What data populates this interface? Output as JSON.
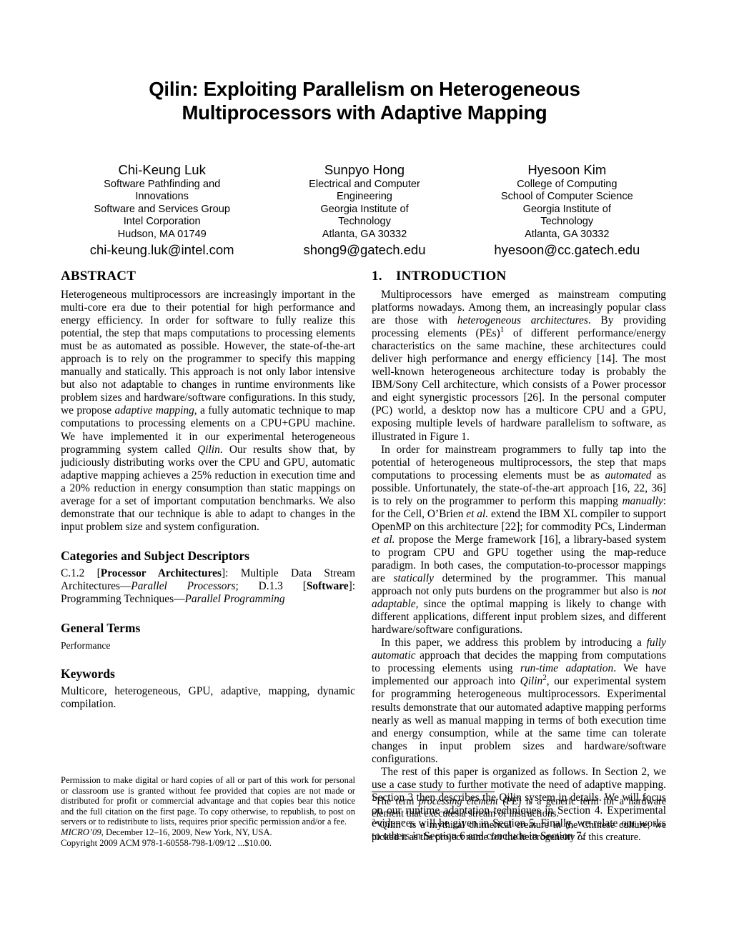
{
  "paper": {
    "title_line1": "Qilin: Exploiting Parallelism on Heterogeneous",
    "title_line2": "Multiprocessors with Adaptive Mapping"
  },
  "authors": [
    {
      "name": "Chi-Keung Luk",
      "affiliation_lines": [
        "Software Pathfinding and",
        "Innovations",
        "Software and Services Group",
        "Intel Corporation",
        "Hudson, MA 01749"
      ],
      "email": "chi-keung.luk@intel.com"
    },
    {
      "name": "Sunpyo Hong",
      "affiliation_lines": [
        "Electrical and Computer",
        "Engineering",
        "Georgia Institute of",
        "Technology",
        "Atlanta, GA 30332"
      ],
      "email": "shong9@gatech.edu"
    },
    {
      "name": "Hyesoon Kim",
      "affiliation_lines": [
        "College of Computing",
        "School of Computer Science",
        "Georgia Institute of",
        "Technology",
        "Atlanta, GA 30332"
      ],
      "email": "hyesoon@cc.gatech.edu"
    }
  ],
  "left_column": {
    "abstract_heading": "ABSTRACT",
    "abstract_text_p1": "Heterogeneous multiprocessors are increasingly important in the multi-core era due to their potential for high performance and energy efficiency. In order for software to fully realize this potential, the step that maps computations to processing elements must be as automated as possible. However, the state-of-the-art approach is to rely on the programmer to specify this mapping manually and statically. This approach is not only labor intensive but also not adaptable to changes in runtime environments like problem sizes and hardware/software configurations. In this study, we propose ",
    "abstract_italic_1": "adaptive mapping",
    "abstract_text_p2": ", a fully automatic technique to map computations to processing elements on a CPU+GPU machine. We have implemented it in our experimental heterogeneous programming system called ",
    "abstract_italic_2": "Qilin",
    "abstract_text_p3": ". Our results show that, by judiciously distributing works over the CPU and GPU, automatic adaptive mapping achieves a 25% reduction in execution time and a 20% reduction in energy consumption than static mappings on average for a set of important computation benchmarks. We also demonstrate that our technique is able to adapt to changes in the input problem size and system configuration.",
    "categories_heading": "Categories and Subject Descriptors",
    "categories_a": "C.1.2 [",
    "categories_b": "Processor Architectures",
    "categories_c": "]: Multiple Data Stream Architectures—",
    "categories_d": "Parallel Processors",
    "categories_e": "; D.1.3 [",
    "categories_f": "Software",
    "categories_g": "]: Programming Techniques—",
    "categories_h": "Parallel Programming",
    "general_terms_heading": "General Terms",
    "general_terms_text": "Performance",
    "keywords_heading": "Keywords",
    "keywords_text": "Multicore, heterogeneous, GPU, adaptive, mapping, dynamic compilation."
  },
  "right_column": {
    "intro_number": "1.",
    "intro_heading": "INTRODUCTION",
    "intro_p1_a": "Multiprocessors have emerged as mainstream computing platforms nowadays. Among them, an increasingly popular class are those with ",
    "intro_p1_it1": "heterogeneous architectures",
    "intro_p1_b": ". By providing processing elements (PEs)",
    "intro_p1_sup1": "1",
    "intro_p1_c": " of different performance/energy characteristics on the same machine, these architectures could deliver high performance and energy efficiency [14]. The most well-known heterogeneous architecture today is probably the IBM/Sony Cell architecture, which consists of a Power processor and eight synergistic processors [26]. In the personal computer (PC) world, a desktop now has a multicore CPU and a GPU, exposing multiple levels of hardware parallelism to software, as illustrated in Figure 1.",
    "intro_p2_a": "In order for mainstream programmers to fully tap into the potential of heterogeneous multiprocessors, the step that maps computations to processing elements must be as ",
    "intro_p2_it1": "automated",
    "intro_p2_b": " as possible. Unfortunately, the state-of-the-art approach [16, 22, 36] is to rely on the programmer to perform this mapping ",
    "intro_p2_it2": "manually",
    "intro_p2_c": ": for the Cell, O’Brien ",
    "intro_p2_it3": "et al.",
    "intro_p2_d": " extend the IBM XL compiler to support OpenMP on this architecture [22]; for commodity PCs, Linderman ",
    "intro_p2_it4": "et al.",
    "intro_p2_e": " propose the Merge framework [16], a library-based system to program CPU and GPU together using the map-reduce paradigm. In both cases, the computation-to-processor mappings are ",
    "intro_p2_it5": "statically",
    "intro_p2_f": " determined by the programmer. This manual approach not only puts burdens on the programmer but also is ",
    "intro_p2_it6": "not adaptable",
    "intro_p2_g": ", since the optimal mapping is likely to change with different applications, different input problem sizes, and different hardware/software configurations.",
    "intro_p3_a": "In this paper, we address this problem by introducing a ",
    "intro_p3_it1": "fully automatic",
    "intro_p3_b": " approach that decides the mapping from computations to processing elements using ",
    "intro_p3_it2": "run-time adaptation",
    "intro_p3_c": ". We have implemented our approach into ",
    "intro_p3_it3": "Qilin",
    "intro_p3_sup2": "2",
    "intro_p3_d": ", our experimental system for programming heterogeneous multiprocessors. Experimental results demonstrate that our automated adaptive mapping performs nearly as well as manual mapping in terms of both execution time and energy consumption, while at the same time can tolerate changes in input problem sizes and hardware/software configurations.",
    "intro_p4": "The rest of this paper is organized as follows. In Section 2, we use a case study to further motivate the need of adaptive mapping. Section 3 then describes the Qilin system in details. We will focus on our runtime adaptation techniques in Section 4. Experimental evidences will be given in Section 5. Finally, we relate our works to others in Section 6 and conclude in Section 7."
  },
  "copyright": {
    "permission_text": "Permission to make digital or hard copies of all or part of this work for personal or classroom use is granted without fee provided that copies are not made or distributed for profit or commercial advantage and that copies bear this notice and the full citation on the first page. To copy otherwise, to republish, to post on servers or to redistribute to lists, requires prior specific permission and/or a fee.",
    "conference_italic": "MICRO’09",
    "conference_rest": ", December 12–16, 2009, New York, NY, USA.",
    "copyright_line": "Copyright 2009 ACM 978-1-60558-798-1/09/12 ...$10.00."
  },
  "footnotes": {
    "fn1_marker": "1",
    "fn1_a": "The term ",
    "fn1_it": "processing element",
    "fn1_b": " (PE) is a generic term for a hardware element that executes a stream of instructions.",
    "fn2_marker": "2",
    "fn2_text": "“Qilin” is a mythical chimerical creature in the Chinese culture; we picked it as the project name for the heterogeneity of this creature."
  }
}
